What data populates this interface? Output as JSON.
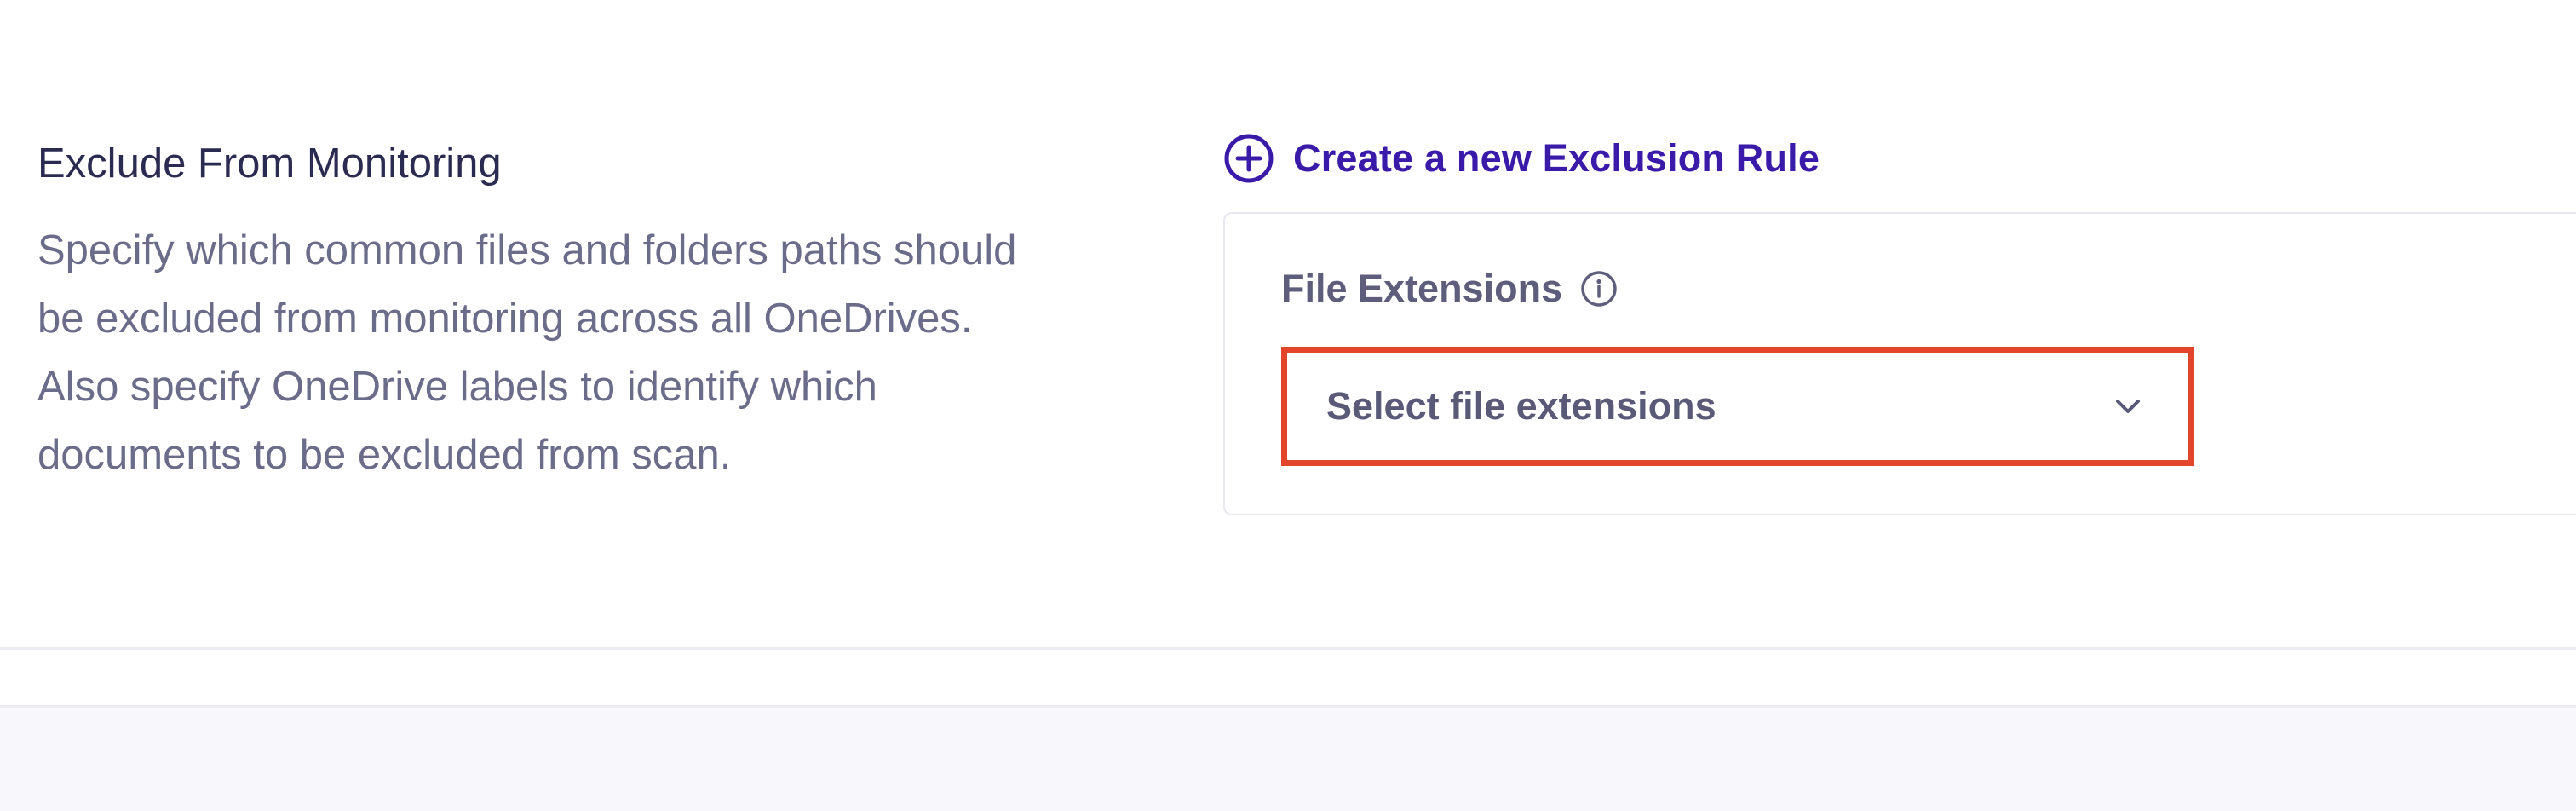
{
  "section": {
    "title": "Exclude From Monitoring",
    "description": "Specify which common files and folders paths should be excluded from monitoring across all OneDrives. Also specify OneDrive labels to identify which documents to be excluded from scan."
  },
  "create_rule": {
    "label": "Create a new Exclusion Rule",
    "icon": "plus-circle-icon"
  },
  "rule_card": {
    "field_label": "File Extensions",
    "info_icon": "info-icon",
    "select": {
      "placeholder": "Select file extensions",
      "icon": "chevron-down-icon"
    }
  },
  "colors": {
    "accent": "#3a1aa8",
    "highlight": "#e3452a",
    "text_primary": "#2b2b52",
    "text_secondary": "#6b6b8a"
  }
}
